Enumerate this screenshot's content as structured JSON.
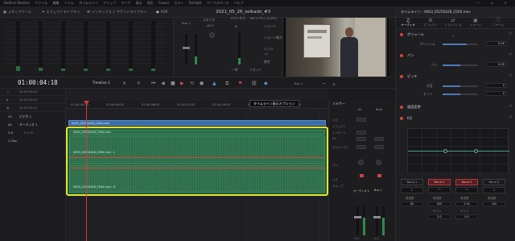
{
  "menubar": {
    "items": [
      "DaVinci Resolve",
      "ファイル",
      "編集",
      "トリム",
      "タイムライン",
      "クリップ",
      "マーク",
      "表示",
      "再生",
      "Fusion",
      "カラー",
      "Fairlight",
      "ワークスペース",
      "ヘルプ"
    ],
    "window_controls": "— ☐ ✕"
  },
  "toolbar": {
    "media_pool": "メディアプール",
    "effects_library": "エフェクトライブラリ",
    "index": "インデックス",
    "sound_library": "サウンドライブラリ",
    "adr": "ADR",
    "project_title": "2021_05_26_seikado_#3",
    "mixer": "ミキサー",
    "meters": "メーター",
    "metadata": "メタデータ",
    "inspector": "インスペクタ"
  },
  "monitors": {
    "bus_label": "Bus 1",
    "studio_label": "スタジオ",
    "level_value": "-41.2",
    "loudness_label": "ラウドネス",
    "loudness_standard": "BS.1770-1 (LUFS)",
    "m_label": "M",
    "short_label": "ショート",
    "short_max_label": "ショート最大",
    "range_label": "レンジ",
    "integrated_label": "統合",
    "pause_label": "一時",
    "reset_label": "リセット",
    "value_neg_inf": "-∞"
  },
  "viewer": {
    "progress_fraction": 0.55
  },
  "inspector": {
    "clip_title": "タイムライン - A003_05250428_C004.mov",
    "tabs": [
      {
        "label": "オーディオ",
        "glyph": "♫"
      },
      {
        "label": "エフェクト",
        "glyph": "⚙"
      },
      {
        "label": "トランジション",
        "glyph": "⇄"
      },
      {
        "label": "イメージ",
        "glyph": "▣"
      },
      {
        "label": "ファイル",
        "glyph": "ⓘ"
      }
    ],
    "volume_section": "ボリューム",
    "volume_label": "ボリューム",
    "volume_value": "0.00",
    "pan_section": "パン",
    "pan_label": "パン",
    "pan_value": "0.00",
    "pitch_section": "ピッチ",
    "semitones_label": "半音",
    "semitones_value": "0",
    "cents_label": "セント",
    "cents_value": "0",
    "speed_section": "速度変更",
    "eq_section": "EQ",
    "bands": [
      {
        "label": "Band 1",
        "active": false,
        "shape": "╯",
        "freq_label": "周波数",
        "freq_value": "80",
        "gain_label": "ゲイン",
        "gain_value": ""
      },
      {
        "label": "Band 2",
        "active": true,
        "shape": "⌒",
        "freq_label": "周波数",
        "freq_value": "500",
        "gain_label": "ゲイン",
        "gain_value": "0.0"
      },
      {
        "label": "Band 3",
        "active": true,
        "shape": "⌒",
        "freq_label": "周波数",
        "freq_value": "1.5k",
        "gain_label": "ゲイン",
        "gain_value": "0.0"
      },
      {
        "label": "Band 4",
        "active": false,
        "shape": "╰",
        "freq_label": "周波数",
        "freq_value": "10k",
        "gain_label": "ゲイン",
        "gain_value": ""
      }
    ]
  },
  "timeline_header": {
    "timecode": "01:00:04:18",
    "timeline_name": "Timeline 1",
    "bus_select": "Bus 1",
    "ruler_ticks": [
      "01:00:00:00",
      "01:00:04:00",
      "01:00:08:00",
      "01:00:12:00",
      "01:00:16:00",
      "01:00:20:00",
      "01:00:24:00"
    ]
  },
  "track_heads": {
    "rows": [
      {
        "icon": "◎",
        "tc": "00:00:00:00"
      },
      {
        "icon": "▶",
        "tc": "00:00:00:00"
      },
      {
        "icon": "▣",
        "tc": "00:00:00:00"
      }
    ],
    "video_track": {
      "num": "V1",
      "name": "ビデオ 1"
    },
    "audio_track": {
      "num": "A1",
      "name": "オーディオ 1",
      "channel": "2.0",
      "clips": "1 Clip"
    }
  },
  "clips": {
    "video_clip": "A003_05250428_C004.mov",
    "audio_clip_top": "A003_05250428_C004.mov",
    "audio_clip_mid": "A003_05250428_C004.mov - L",
    "audio_clip_bot": "A003_05250428_C004.mov - R"
  },
  "tooltip": "タイムライン表示オプション",
  "mixer": {
    "title": "ミキサー",
    "col_a1": "A1",
    "col_bus1": "Bus1",
    "input_label": "入力",
    "effects_label": "エフェクト",
    "insert_label": "インサート",
    "eq_label": "EQ",
    "dynamics_label": "ダイナミクス",
    "pan_label": "パン",
    "bus_label": "バス",
    "group_label": "グループ",
    "track_name": "オーディオ 1",
    "bus_name": "Bus 1",
    "fader_value_1": "0.0",
    "fader_value_2": "0.0"
  },
  "colors": {
    "accent_red": "#d83838",
    "selection_yellow": "#e6e32c",
    "audio_green": "#2f6e4c",
    "video_blue": "#3a6fa8"
  }
}
